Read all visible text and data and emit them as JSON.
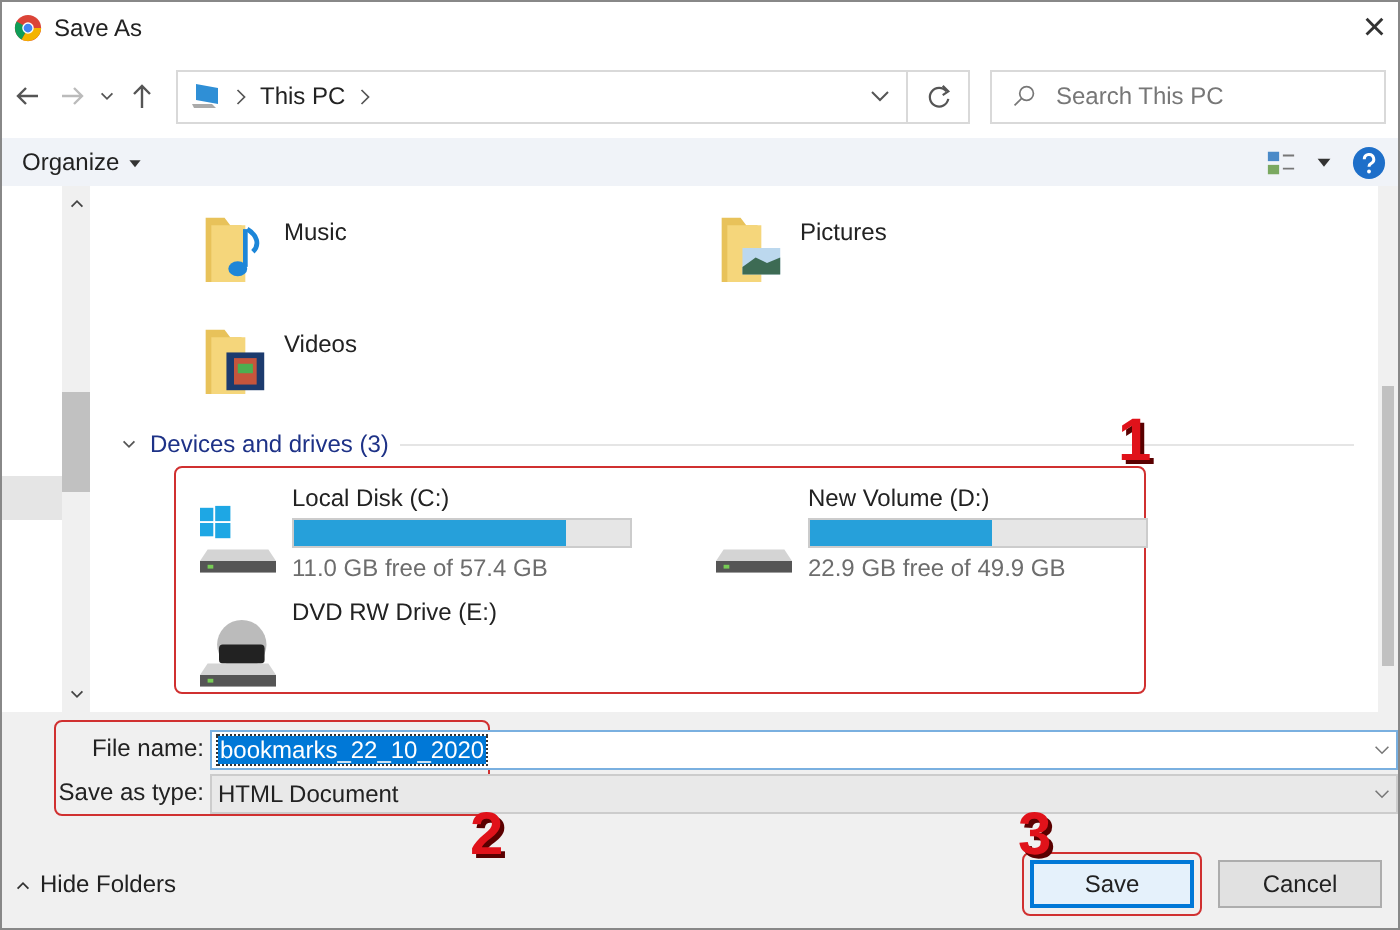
{
  "window": {
    "title": "Save As",
    "close": "×"
  },
  "navigation": {
    "path": [
      "This PC"
    ],
    "search": {
      "placeholder": "Search This PC"
    }
  },
  "toolbar": {
    "organize": "Organize"
  },
  "folders": [
    {
      "name": "Music",
      "kind": "music"
    },
    {
      "name": "Pictures",
      "kind": "pictures"
    },
    {
      "name": "Videos",
      "kind": "videos"
    }
  ],
  "devices_section": {
    "label": "Devices and drives (3)",
    "expanded": true
  },
  "drives": [
    {
      "name": "Local Disk (C:)",
      "kind": "system",
      "level": 0.81,
      "free": "11.0 GB free of 57.4 GB"
    },
    {
      "name": "New Volume (D:)",
      "kind": "disk",
      "level": 0.54,
      "free": "22.9 GB free of 49.9 GB"
    },
    {
      "name": "DVD RW Drive (E:)",
      "kind": "dvd"
    }
  ],
  "form": {
    "file_name_label": "File name:",
    "file_name": "bookmarks_22_10_2020",
    "type_label": "Save as type:",
    "type": "HTML Document"
  },
  "footer": {
    "hide_folders": "Hide Folders",
    "buttons": [
      "Save",
      "Cancel"
    ]
  },
  "annotations": [
    "1",
    "2",
    "3"
  ]
}
